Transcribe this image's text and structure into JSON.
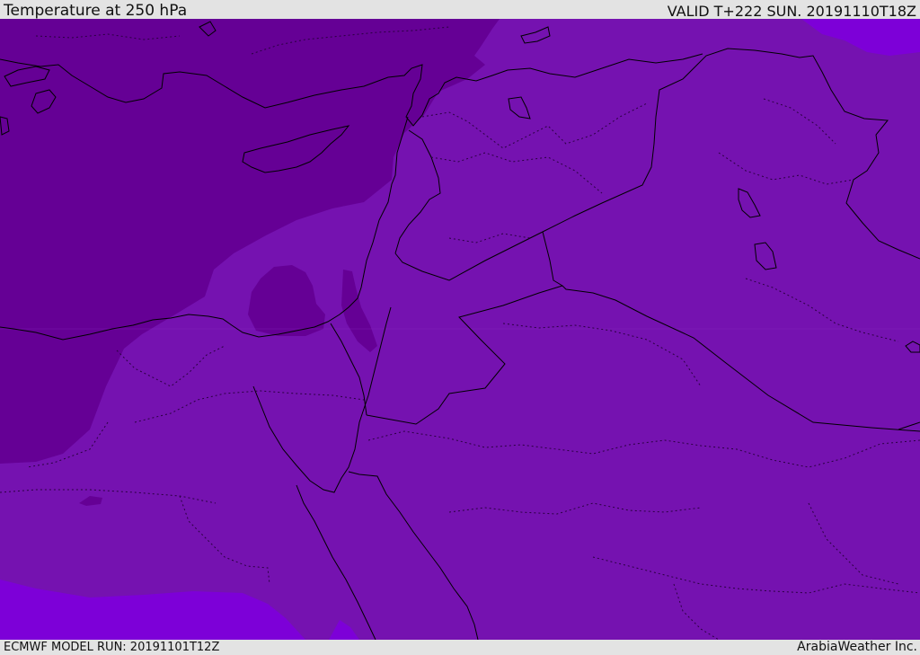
{
  "header": {
    "title": "Temperature at 250 hPa",
    "valid_time": "VALID T+222 SUN. 20191110T18Z"
  },
  "footer": {
    "model_run": "ECMWF MODEL RUN: 20191101T12Z",
    "credit": "ArabiaWeather Inc."
  },
  "map": {
    "colors": {
      "cold_shade": "#650095",
      "mid_shade": "#7512b0",
      "warm_shade": "#7d00d8",
      "border_line": "#000000",
      "admin_line": "#2a0040"
    }
  }
}
